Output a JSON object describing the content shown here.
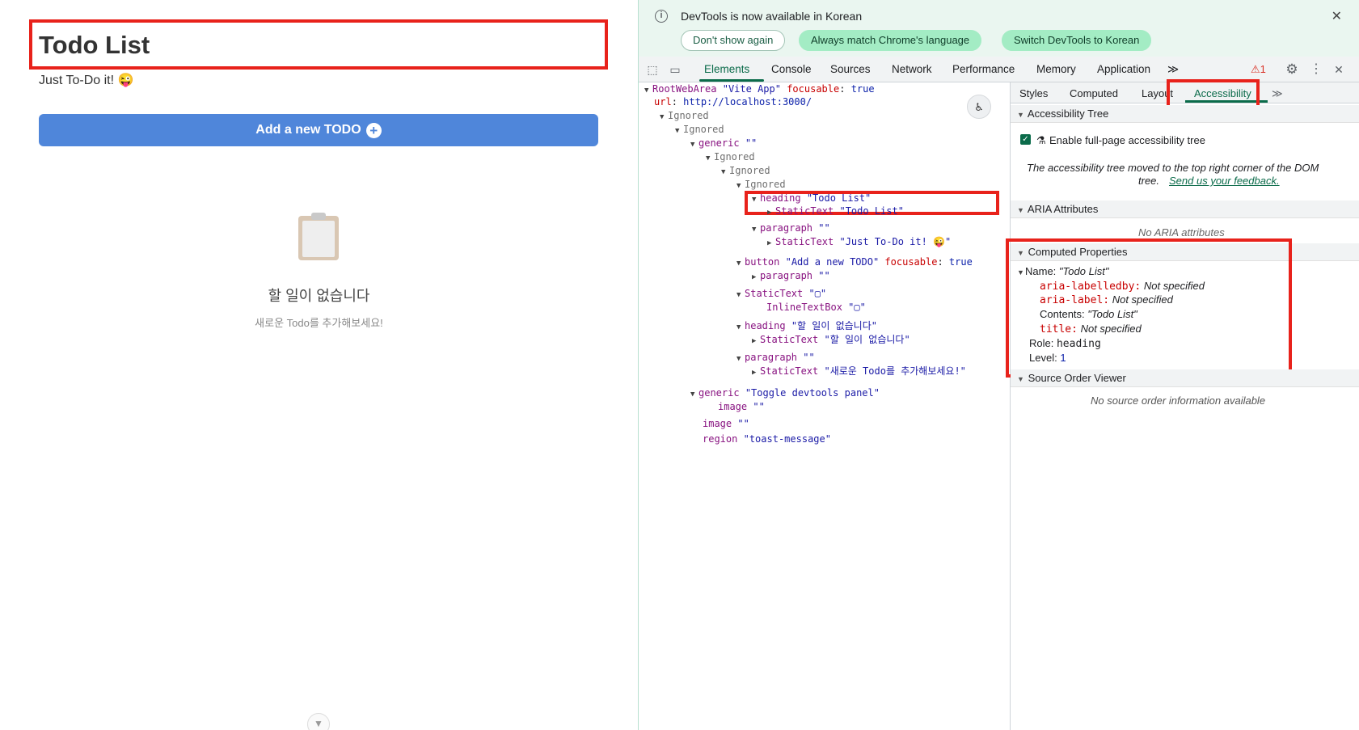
{
  "app": {
    "title": "Todo List",
    "subtitle": "Just To-Do it! 😜",
    "add_button": "Add a new TODO",
    "add_icon": "+",
    "empty_title": "할 일이 없습니다",
    "empty_subtitle": "새로운 Todo를 추가해보세요!",
    "toggle_icon": "▼"
  },
  "devtools": {
    "infobar": {
      "icon": "i",
      "message": "DevTools is now available in Korean",
      "dont_show": "Don't show again",
      "match_language": "Always match Chrome's language",
      "switch_korean": "Switch DevTools to Korean",
      "close": "✕"
    },
    "toolbar": {
      "inspect_icon": "⬚",
      "device_icon": "▭",
      "tabs": [
        "Elements",
        "Console",
        "Sources",
        "Network",
        "Performance",
        "Memory",
        "Application"
      ],
      "more": "≫",
      "warnings": "⚠1",
      "settings_icon": "⚙",
      "menu_icon": "⋮",
      "close_icon": "✕"
    },
    "tree": {
      "root_label": "RootWebArea",
      "root_name": "\"Vite App\"",
      "focusable_key": "focusable",
      "true_val": "true",
      "url_key": "url",
      "url_val": "http://localhost:3000/",
      "ignored": "Ignored",
      "generic": "generic",
      "empty_str": "\"\"",
      "heading": "heading",
      "heading_name": "\"Todo List\"",
      "static_text": "StaticText",
      "static_todo": "\"Todo List\"",
      "paragraph": "paragraph",
      "static_justdo": "\"Just To-Do it! 😜\"",
      "button": "button",
      "button_name": "\"Add a new TODO\"",
      "static_clip": "\"▢\"",
      "inline_box": "InlineTextBox",
      "heading2_name": "\"할 일이 없습니다\"",
      "static_empty": "\"할 일이 없습니다\"",
      "static_add": "\"새로운 Todo를 추가해보세요!\"",
      "generic_toggle": "\"Toggle devtools panel\"",
      "image": "image",
      "region": "region",
      "region_name": "\"toast-message\"",
      "a11y_icon": "♿"
    },
    "side": {
      "tabs": [
        "Styles",
        "Computed",
        "Layout",
        "Accessibility"
      ],
      "more": "≫",
      "tree_section": "Accessibility Tree",
      "enable_label": "Enable full-page accessibility tree",
      "moved_line1": "The accessibility tree moved to the top right corner of the DOM",
      "moved_line2": "tree.",
      "feedback": "Send us your feedback.",
      "aria_section": "ARIA Attributes",
      "no_aria": "No ARIA attributes",
      "computed_section": "Computed Properties",
      "name_label": "Name:",
      "name_val": "\"Todo List\"",
      "labelledby_key": "aria-labelledby:",
      "label_key": "aria-label:",
      "not_specified": "Not specified",
      "contents_key": "Contents:",
      "contents_val": "\"Todo List\"",
      "title_key": "title:",
      "role_key": "Role:",
      "role_val": "heading",
      "level_key": "Level:",
      "level_val": "1",
      "source_section": "Source Order Viewer",
      "no_source": "No source order information available"
    }
  },
  "colors": {
    "accent_red": "#e8221b",
    "button_blue": "#4f86da",
    "devtools_green": "#0b6b4a"
  }
}
